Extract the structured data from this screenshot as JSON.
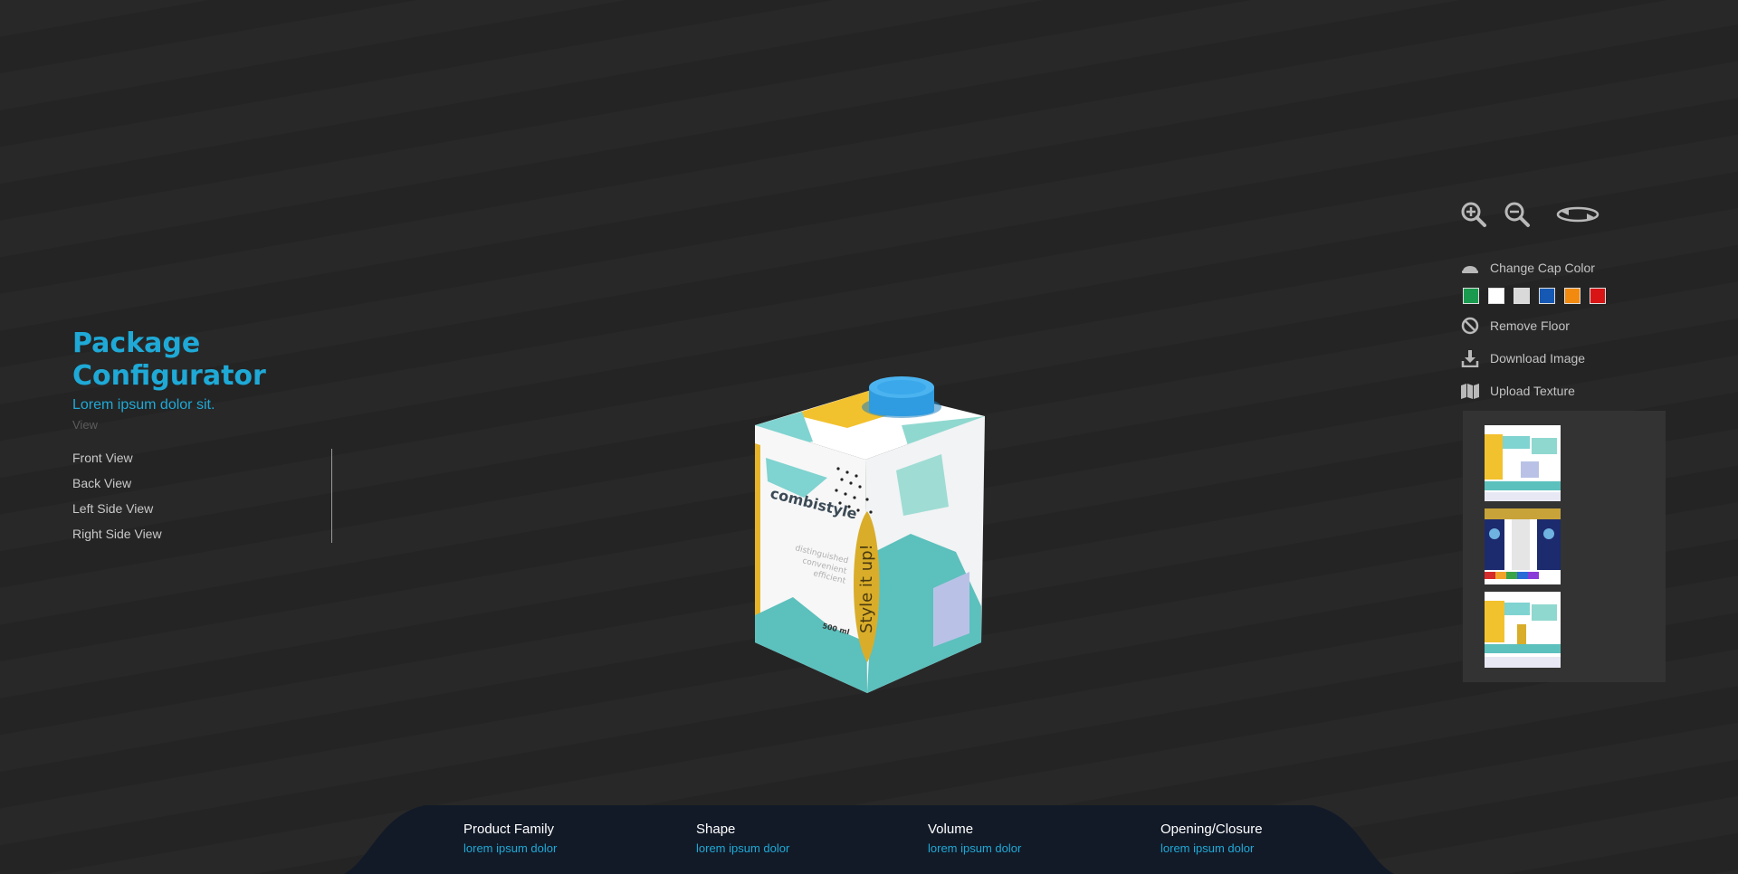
{
  "app": {
    "title": "Package Configurator",
    "subtitle": "Lorem ipsum dolor sit.",
    "view_label": "View"
  },
  "views": [
    {
      "label": "Front View"
    },
    {
      "label": "Back View"
    },
    {
      "label": "Left Side View"
    },
    {
      "label": "Right Side View"
    }
  ],
  "package": {
    "brand": "combistyle",
    "tagline": "Style it up!",
    "copy_lines": [
      "distinguished",
      "convenient",
      "efficient"
    ],
    "volume": "500 ml",
    "cap_color": "#2f9be0"
  },
  "toolbar": {
    "zoom_in_icon": "zoom-in-icon",
    "zoom_out_icon": "zoom-out-icon",
    "rotate_icon": "rotate-icon",
    "change_cap_color": "Change Cap Color",
    "remove_floor": "Remove Floor",
    "download_image": "Download Image",
    "upload_texture": "Upload Texture"
  },
  "cap_colors": [
    "#1a9a4e",
    "#ffffff",
    "#d9d9d9",
    "#1559b4",
    "#f28a0f",
    "#d81414"
  ],
  "specs": [
    {
      "label": "Product Family",
      "value": "lorem ipsum dolor"
    },
    {
      "label": "Shape",
      "value": "lorem ipsum dolor"
    },
    {
      "label": "Volume",
      "value": "lorem ipsum dolor"
    },
    {
      "label": "Opening/Closure",
      "value": "lorem ipsum dolor"
    }
  ],
  "colors": {
    "accent": "#1fa9d6",
    "background": "#252525",
    "bottom_bar": "#121a28"
  }
}
